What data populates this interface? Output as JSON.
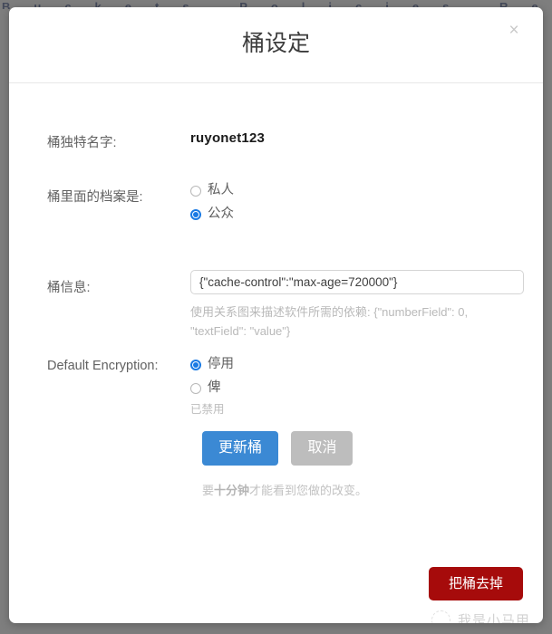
{
  "background": {
    "bleed_text": "Buckets  Policies  Records  Dashboard",
    "backdrop_color": "#7e7e7e"
  },
  "modal": {
    "title": "桶设定",
    "close_label": "×",
    "rows": {
      "bucket_name": {
        "label": "桶独特名字:",
        "value": "ruyonet123"
      },
      "access": {
        "label": "桶里面的档案是:",
        "options": [
          {
            "label": "私人",
            "checked": false
          },
          {
            "label": "公众",
            "checked": true
          }
        ]
      },
      "bucket_info": {
        "label": "桶信息:",
        "value": "{\"cache-control\":\"max-age=720000\"}",
        "placeholder": "{\"cache-control\":\"max-age=720000\"}",
        "help": "使用关系图来描述软件所需的依赖: {\"numberField\": 0, \"textField\": \"value\"}"
      },
      "encryption": {
        "label": "Default Encryption:",
        "options": [
          {
            "label": "停用",
            "checked": true
          },
          {
            "label": "俾",
            "checked": false
          }
        ],
        "status": "已禁用"
      }
    },
    "actions": {
      "submit_label": "更新桶",
      "cancel_label": "取消",
      "note_prefix": "要",
      "note_bold": "十分钟",
      "note_suffix": "才能看到您做的改变。"
    },
    "danger": {
      "delete_label": "把桶去掉"
    }
  },
  "watermark": {
    "text": "我是小马甲",
    "icon": "circle-logo-icon"
  },
  "colors": {
    "accent_blue": "#1a7ae4",
    "button_blue": "#3b89d4",
    "button_gray": "#bdbdbd",
    "danger_red": "#a60b0b"
  }
}
